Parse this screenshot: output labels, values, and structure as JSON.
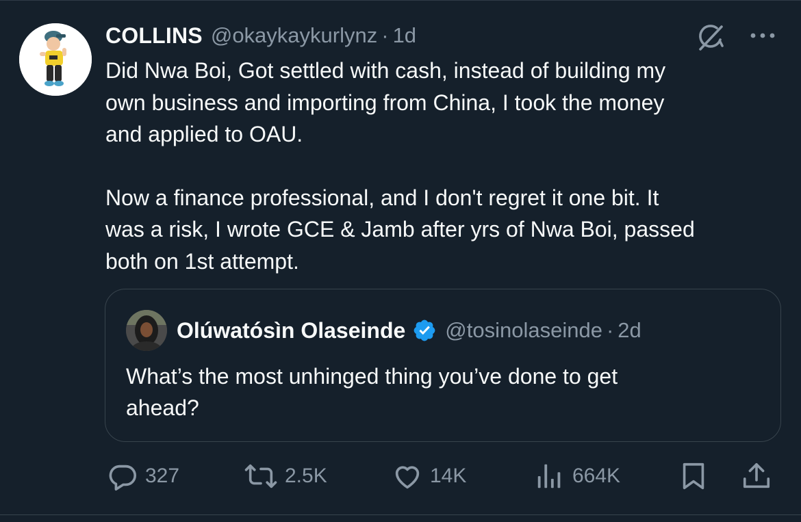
{
  "tweet": {
    "author_name": "COLLINS",
    "author_handle": "@okaykaykurlynz",
    "separator": "·",
    "time": "1d",
    "paragraphs": [
      "Did Nwa Boi, Got settled with cash, instead of building my\nown business and importing from China, I took the money\nand applied to OAU.",
      "Now a finance professional, and I don't regret it one bit. It\nwas a risk, I wrote GCE & Jamb after yrs of Nwa Boi, passed\nboth on 1st attempt."
    ]
  },
  "quote": {
    "author_name": "Olúwatósìn Olaseinde",
    "author_handle": "@tosinolaseinde",
    "separator": "·",
    "time": "2d",
    "verified": true,
    "text": "What’s the most unhinged thing you’ve done to get\nahead?"
  },
  "actions": {
    "replies": "327",
    "reposts": "2.5K",
    "likes": "14K",
    "views": "664K"
  },
  "icons": [
    "grok-icon",
    "more-icon",
    "verified-icon",
    "reply-icon",
    "repost-icon",
    "like-icon",
    "views-icon",
    "bookmark-icon",
    "share-icon"
  ],
  "colors": {
    "background": "#15202b",
    "text_primary": "#f7f9f9",
    "text_secondary": "#8b98a5",
    "border": "#38444d",
    "verified": "#1d9bf0"
  }
}
